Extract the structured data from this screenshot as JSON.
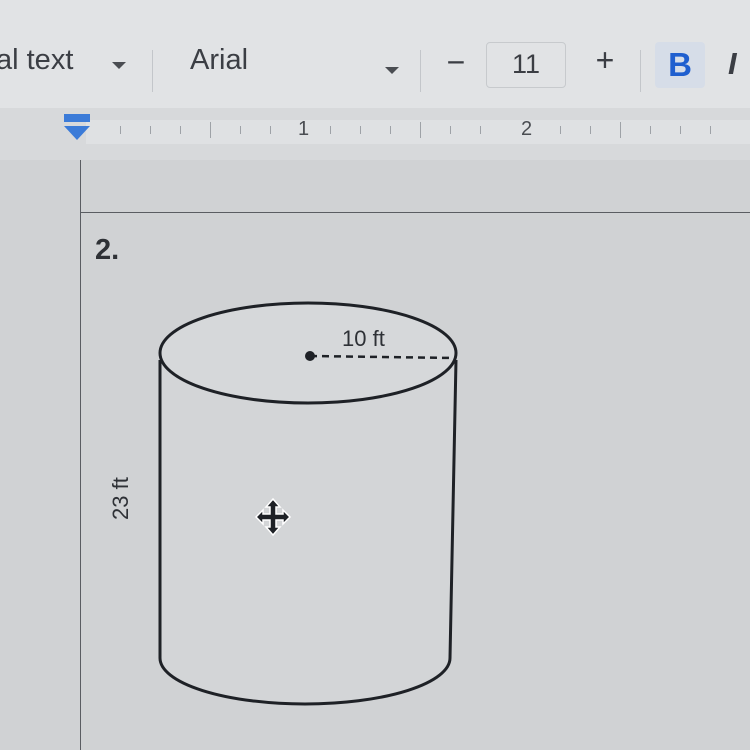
{
  "toolbar": {
    "paragraph_style": "al text",
    "font_family": "Arial",
    "decrease_size": "−",
    "font_size": "11",
    "increase_size": "+",
    "bold": "B",
    "italic": "I"
  },
  "ruler": {
    "labels": [
      "1",
      "2"
    ]
  },
  "document": {
    "question_number": "2.",
    "figure": {
      "shape": "cylinder",
      "radius_label": "10 ft",
      "height_label": "23 ft"
    }
  },
  "colors": {
    "bold_active_bg": "#d6dde8",
    "bold_active_text": "#1f5fcf",
    "indent_marker": "#3b7bd8"
  },
  "icons": [
    "chevron-down-icon",
    "indent-marker-icon",
    "move-cursor-icon"
  ]
}
